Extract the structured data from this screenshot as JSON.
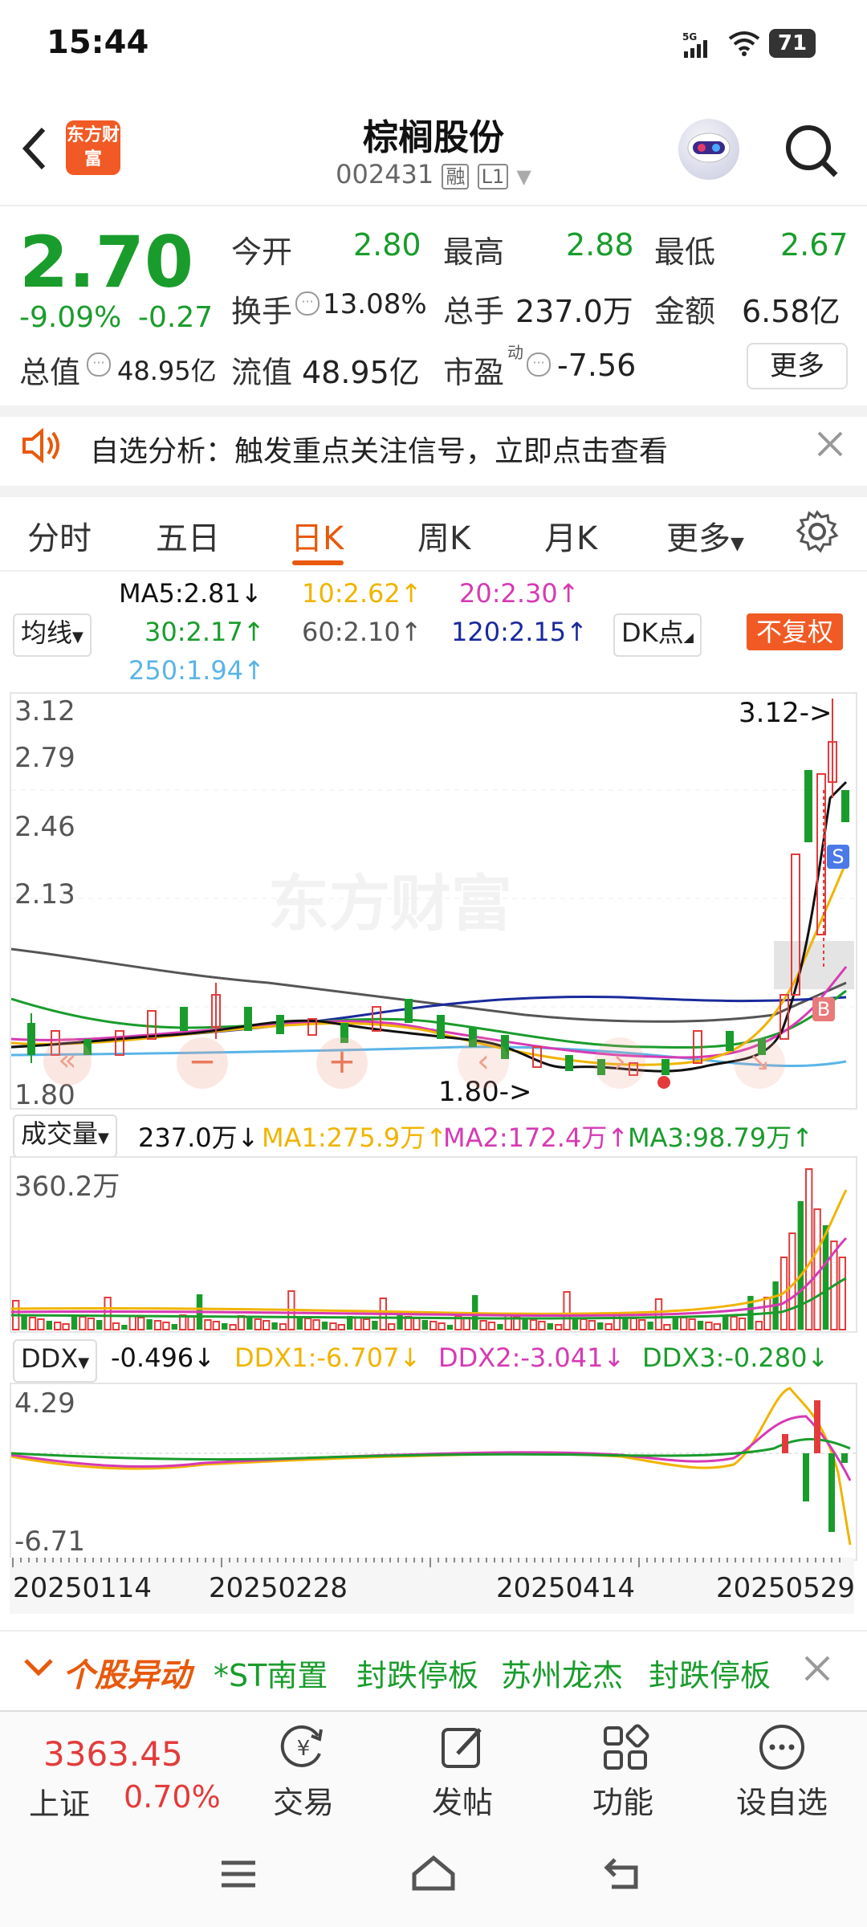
{
  "status": {
    "time": "15:44",
    "battery": "71",
    "network": "5G"
  },
  "header": {
    "title": "棕榈股份",
    "code": "002431",
    "badge_rong": "融",
    "badge_level": "L1",
    "logo_text": "东方财富"
  },
  "quote": {
    "price": "2.70",
    "change_pct": "-9.09%",
    "change_amt": "-0.27",
    "open_label": "今开",
    "open": "2.80",
    "high_label": "最高",
    "high": "2.88",
    "low_label": "最低",
    "low": "2.67",
    "turnover_label": "换手",
    "turnover": "13.08%",
    "volume_label": "总手",
    "volume": "237.0万",
    "amount_label": "金额",
    "amount": "6.58亿",
    "mktcap_label": "总值",
    "mktcap": "48.95亿",
    "float_label": "流值",
    "float_cap": "48.95亿",
    "pe_label": "市盈",
    "pe_super": "动",
    "pe": "-7.56",
    "more": "更多"
  },
  "notice": {
    "text": "自选分析：触发重点关注信号，立即点击查看"
  },
  "tabs": [
    "分时",
    "五日",
    "日K",
    "周K",
    "月K",
    "更多"
  ],
  "active_tab": "日K",
  "indicators": {
    "ma_selector": "均线",
    "ma5": "MA5:2.81↓",
    "ma10": "10:2.62↑",
    "ma20": "20:2.30↑",
    "ma30": "30:2.17↑",
    "ma60": "60:2.10↑",
    "ma120": "120:2.15↑",
    "ma250": "250:1.94↑",
    "dk": "DK点",
    "fq": "不复权"
  },
  "kline": {
    "y_labels": [
      "3.12",
      "2.79",
      "2.46",
      "2.13",
      "1.80"
    ],
    "max_marker": "3.12->",
    "min_marker": "1.80->",
    "watermark": "东方财富",
    "signal_s": "S",
    "signal_b": "B"
  },
  "volume": {
    "selector": "成交量",
    "value": "237.0万↓",
    "ma1": "MA1:275.9万↑",
    "ma2": "MA2:172.4万↑",
    "ma3": "MA3:98.79万↑",
    "top_label": "360.2万"
  },
  "ddx": {
    "selector": "DDX",
    "value": "-0.496↓",
    "ddx1": "DDX1:-6.707↓",
    "ddx2": "DDX2:-3.041↓",
    "ddx3": "DDX3:-0.280↓",
    "top_label": "4.29",
    "bottom_label": "-6.71"
  },
  "dates": [
    "20250114",
    "20250228",
    "20250414",
    "20250529"
  ],
  "ticker": {
    "label": "个股异动",
    "item1_name": "*ST南置",
    "item1_event": "封跌停板",
    "item2_name": "苏州龙杰",
    "item2_event": "封跌停板"
  },
  "bottom": {
    "index_value": "3363.45",
    "index_name": "上证",
    "index_change": "0.70%",
    "trade": "交易",
    "post": "发帖",
    "func": "功能",
    "watch": "设自选"
  },
  "colors": {
    "up": "#e33b3b",
    "down": "#1a9c2c",
    "accent": "#e8590c",
    "ma5": "#111111",
    "ma10": "#f0b400",
    "ma20": "#d63ab4",
    "ma30": "#1a9c2c",
    "ma60": "#555555",
    "ma120": "#1a2a9c",
    "ma250": "#5ab4e8"
  }
}
